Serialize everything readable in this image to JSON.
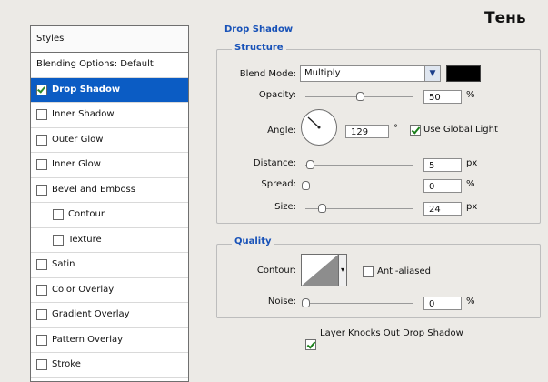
{
  "caption": "Тень",
  "styles_panel": {
    "header": "Styles",
    "items": [
      {
        "label": "Blending Options: Default",
        "checkbox": false,
        "checked": false,
        "selected": false,
        "indent": false
      },
      {
        "label": "Drop Shadow",
        "checkbox": true,
        "checked": true,
        "selected": true,
        "indent": false
      },
      {
        "label": "Inner Shadow",
        "checkbox": true,
        "checked": false,
        "selected": false,
        "indent": false
      },
      {
        "label": "Outer Glow",
        "checkbox": true,
        "checked": false,
        "selected": false,
        "indent": false
      },
      {
        "label": "Inner Glow",
        "checkbox": true,
        "checked": false,
        "selected": false,
        "indent": false
      },
      {
        "label": "Bevel and Emboss",
        "checkbox": true,
        "checked": false,
        "selected": false,
        "indent": false
      },
      {
        "label": "Contour",
        "checkbox": true,
        "checked": false,
        "selected": false,
        "indent": true
      },
      {
        "label": "Texture",
        "checkbox": true,
        "checked": false,
        "selected": false,
        "indent": true
      },
      {
        "label": "Satin",
        "checkbox": true,
        "checked": false,
        "selected": false,
        "indent": false
      },
      {
        "label": "Color Overlay",
        "checkbox": true,
        "checked": false,
        "selected": false,
        "indent": false
      },
      {
        "label": "Gradient Overlay",
        "checkbox": true,
        "checked": false,
        "selected": false,
        "indent": false
      },
      {
        "label": "Pattern Overlay",
        "checkbox": true,
        "checked": false,
        "selected": false,
        "indent": false
      },
      {
        "label": "Stroke",
        "checkbox": true,
        "checked": false,
        "selected": false,
        "indent": false
      }
    ]
  },
  "drop_shadow": {
    "title": "Drop Shadow",
    "structure": {
      "title": "Structure",
      "blend_mode_label": "Blend Mode:",
      "blend_mode_value": "Multiply",
      "shadow_color": "#000000",
      "opacity_label": "Opacity:",
      "opacity_value": "50",
      "opacity_unit": "%",
      "angle_label": "Angle:",
      "angle_value": "129",
      "angle_unit": "°",
      "use_global_light_label": "Use Global Light",
      "use_global_light": true,
      "distance_label": "Distance:",
      "distance_value": "5",
      "distance_unit": "px",
      "spread_label": "Spread:",
      "spread_value": "0",
      "spread_unit": "%",
      "size_label": "Size:",
      "size_value": "24",
      "size_unit": "px"
    },
    "quality": {
      "title": "Quality",
      "contour_label": "Contour:",
      "anti_aliased_label": "Anti-aliased",
      "anti_aliased": false,
      "noise_label": "Noise:",
      "noise_value": "0",
      "noise_unit": "%"
    },
    "layer_knocks_out_label": "Layer Knocks Out Drop Shadow",
    "layer_knocks_out": true
  },
  "colors": {
    "selection": "#0b5cc4",
    "group_title": "#1852b8",
    "check": "#1a7f1a"
  },
  "icons": {
    "dropdown": "chevron-down-icon",
    "contour_dropdown": "caret-down-icon"
  }
}
